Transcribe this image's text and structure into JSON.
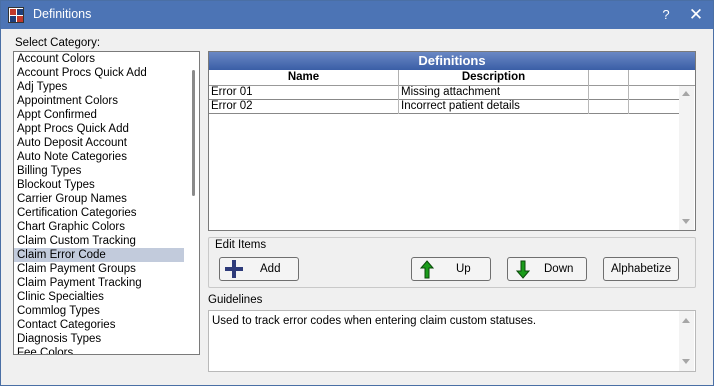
{
  "window": {
    "title": "Definitions",
    "help_glyph": "?",
    "close_glyph": "✕",
    "icon": "grid-app-icon"
  },
  "category": {
    "label": "Select Category:",
    "items": [
      "Account Colors",
      "Account Procs Quick Add",
      "Adj Types",
      "Appointment Colors",
      "Appt Confirmed",
      "Appt Procs Quick Add",
      "Auto Deposit Account",
      "Auto Note Categories",
      "Billing Types",
      "Blockout Types",
      "Carrier Group Names",
      "Certification Categories",
      "Chart Graphic Colors",
      "Claim Custom Tracking",
      "Claim Error Code",
      "Claim Payment Groups",
      "Claim Payment Tracking",
      "Clinic Specialties",
      "Commlog Types",
      "Contact Categories",
      "Diagnosis Types",
      "Fee Colors"
    ],
    "selected": "Claim Error Code"
  },
  "grid": {
    "title": "Definitions",
    "columns": [
      "Name",
      "Description",
      "",
      ""
    ],
    "rows": [
      {
        "name": "Error 01",
        "description": "Missing attachment"
      },
      {
        "name": "Error 02",
        "description": "Incorrect patient details"
      }
    ]
  },
  "edit": {
    "label": "Edit Items",
    "add_label": "Add",
    "up_label": "Up",
    "down_label": "Down",
    "alphabetize_label": "Alphabetize"
  },
  "guidelines": {
    "label": "Guidelines",
    "text": "Used to track error codes when entering claim custom statuses."
  },
  "colors": {
    "titlebar": "#4c74b5",
    "selection": "#c2cbdc",
    "grid_title": "#3a5ea6",
    "arrow_green": "#1a9c1a"
  }
}
